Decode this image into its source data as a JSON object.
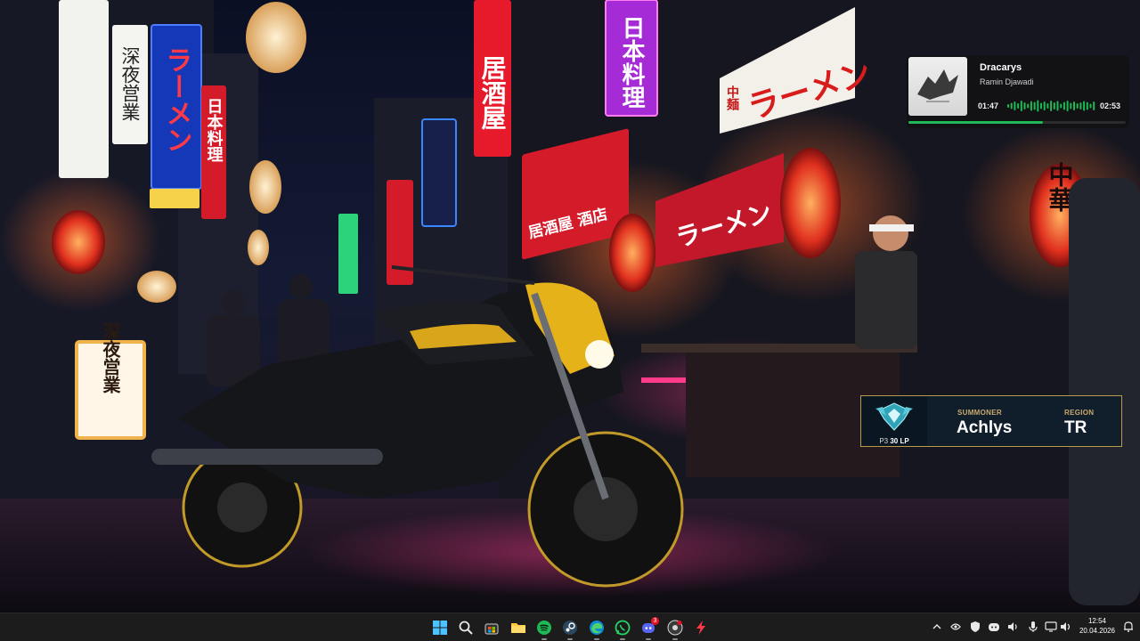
{
  "wallpaper": {
    "signs": {
      "shinya_eigyo": "深夜営業",
      "ramen": "ラーメン",
      "nihon_ryori": "日本料理",
      "izakaya": "居酒屋",
      "izakaya_shuka": "居酒屋 酒店",
      "chuka": "中華",
      "chuka_men": "中麺",
      "ramen_banner": "ラーメン"
    }
  },
  "music_widget": {
    "title": "Dracarys",
    "artist": "Ramin Djawadi",
    "elapsed": "01:47",
    "total": "02:53",
    "progress": 0.62,
    "accent_color": "#1db954",
    "album_art_icon": "game-of-thrones-dragon-icon"
  },
  "summoner_widget": {
    "rank_icon": "rank-emblem-icon",
    "rank_tier": "P3",
    "lp": "30 LP",
    "summoner_label": "SUMMONER",
    "summoner_name": "Achlys",
    "region_label": "REGION",
    "region_value": "TR",
    "border_color": "#b99a4d"
  },
  "taskbar": {
    "apps": [
      {
        "name": "start-icon"
      },
      {
        "name": "search-icon"
      },
      {
        "name": "microsoft-store-icon"
      },
      {
        "name": "file-explorer-icon"
      },
      {
        "name": "spotify-icon"
      },
      {
        "name": "steam-icon"
      },
      {
        "name": "edge-icon"
      },
      {
        "name": "whatsapp-icon"
      },
      {
        "name": "discord-icon",
        "badge": "3"
      },
      {
        "name": "chrome-icon"
      },
      {
        "name": "app-bolt-icon"
      }
    ],
    "tray": [
      {
        "name": "chevron-up-icon"
      },
      {
        "name": "nvidia-icon"
      },
      {
        "name": "security-icon"
      },
      {
        "name": "discord-tray-icon"
      },
      {
        "name": "speaker-icon"
      },
      {
        "name": "microphone-icon"
      },
      {
        "name": "network-icon"
      },
      {
        "name": "volume-icon"
      }
    ],
    "clock": {
      "time": "12:54",
      "date": "20.04.2026"
    },
    "notification_icon": "notification-bell-icon"
  }
}
